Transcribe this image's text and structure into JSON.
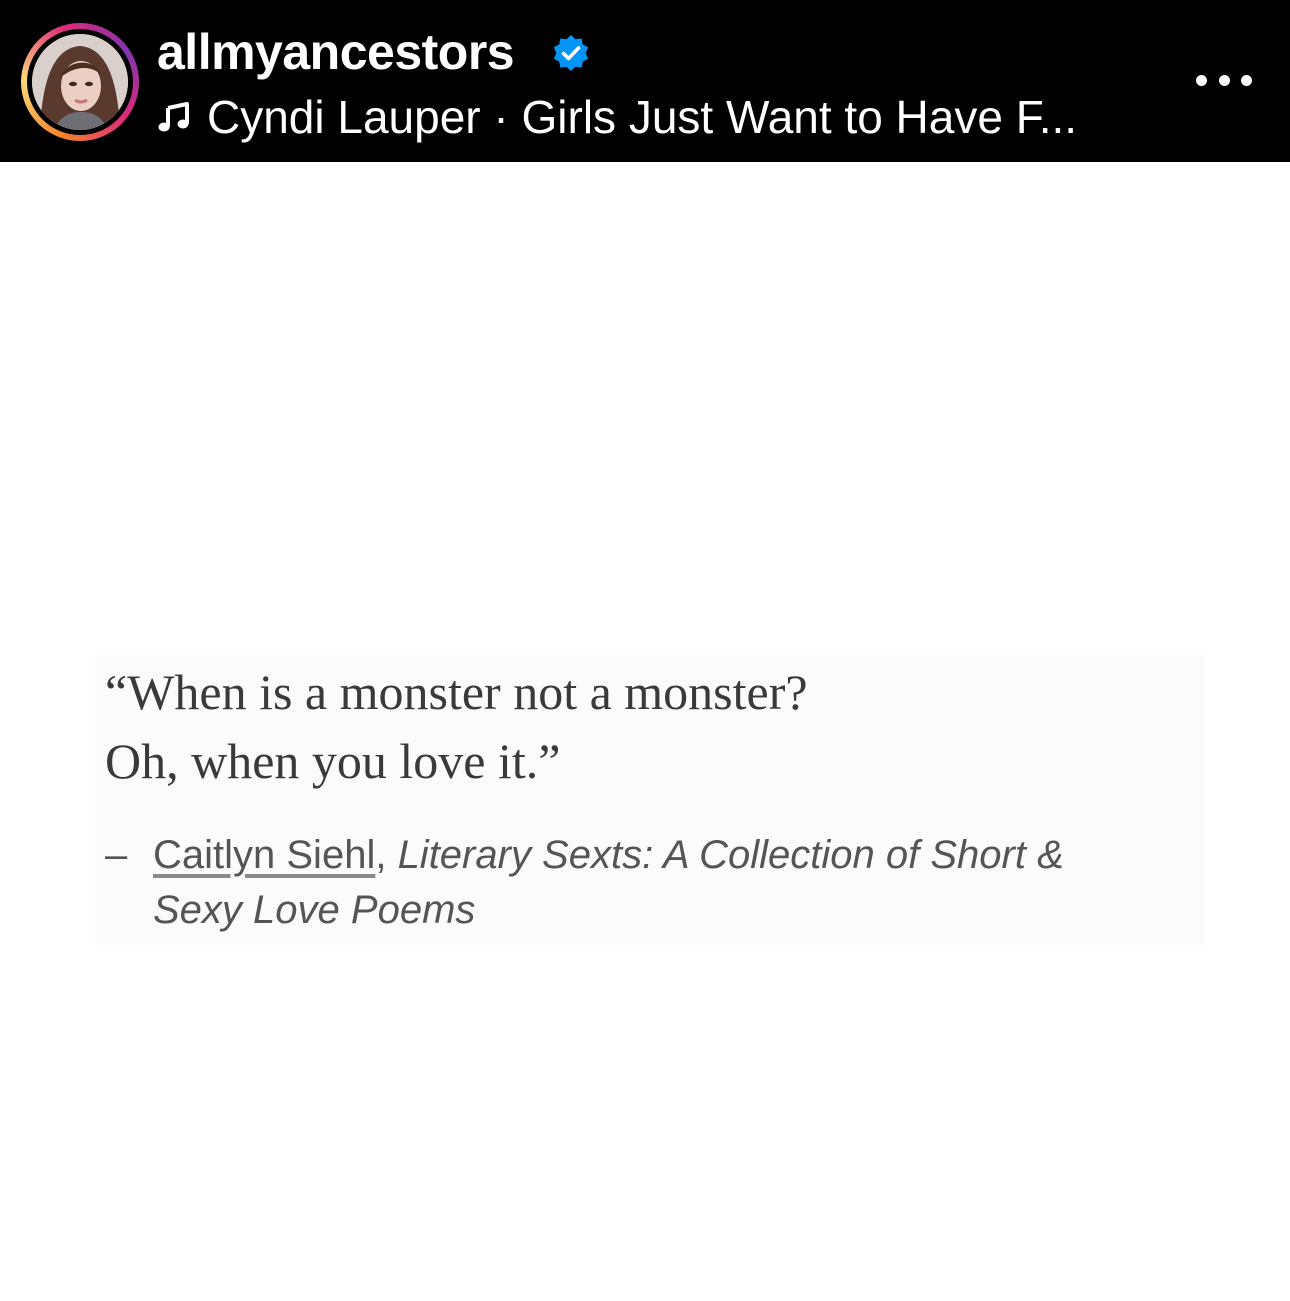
{
  "post_header": {
    "username": "allmyancestors",
    "verified_icon": "verified-badge-icon",
    "audio": {
      "icon": "music-note-icon",
      "artist": "Cyndi Lauper",
      "separator": " · ",
      "track": "Girls Just Want to Have F..."
    },
    "more_icon": "more-options-icon"
  },
  "post_image": {
    "quote_line_1": "“When is a monster not a monster?",
    "quote_line_2": "Oh, when you love it.”",
    "attribution_dash": "–",
    "author": "Caitlyn Siehl",
    "author_separator": ", ",
    "book_title_line_1": "Literary Sexts: A Collection of Short &",
    "book_title_line_2": "Sexy Love Poems"
  },
  "colors": {
    "header_bg": "#000000",
    "verified_blue": "#0095f6",
    "quote_text": "#3a3a3a"
  }
}
